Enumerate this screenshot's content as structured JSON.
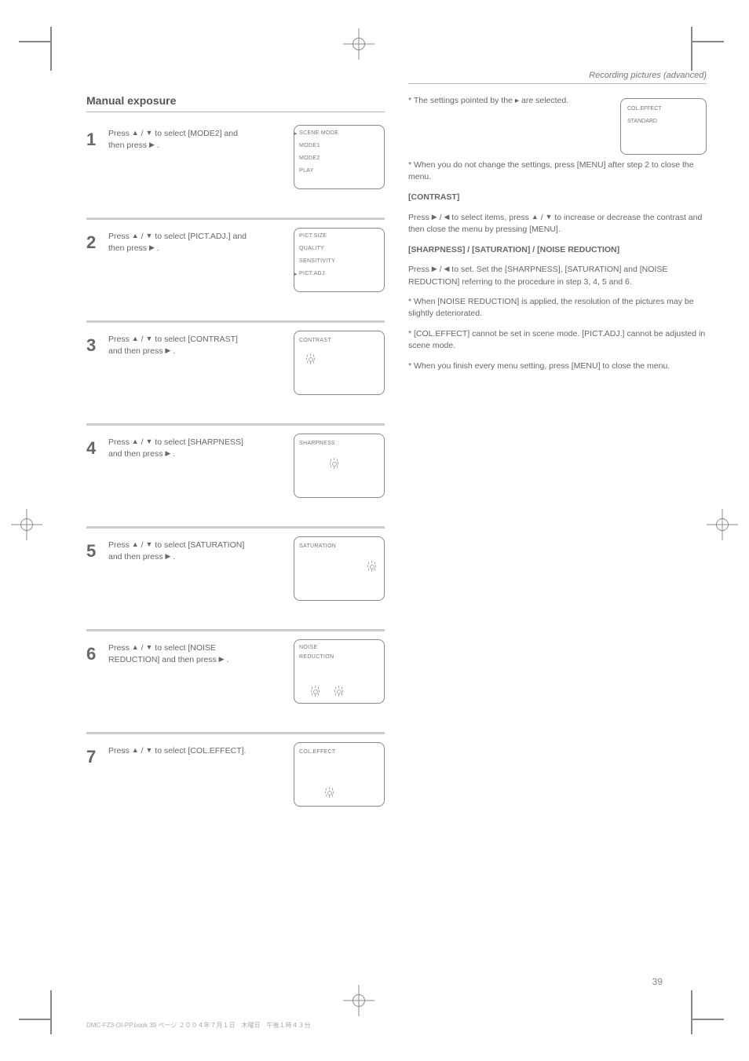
{
  "page_number": "39",
  "footer_line": "DMC-FZ3-OI-PP.book  39 ページ  ２００４年７月１日　木曜日　午後１時４３分",
  "left": {
    "title": "Manual exposure",
    "steps": [
      {
        "num": "1",
        "text_a": "Press ",
        "b1": "▲",
        "mid": "/",
        "b2": "▼",
        "text_b": " to select [MODE2] and then press ",
        "b3": "▶",
        "text_c": ".",
        "lcd": {
          "type": "menu",
          "rows": [
            "SCENE MODE",
            "MODE1",
            "MODE2",
            "PLAY"
          ],
          "sel": 1
        }
      },
      {
        "num": "2",
        "text_a": "Press ",
        "b1": "▲",
        "mid": "/",
        "b2": "▼",
        "text_b": " to select [PICT.ADJ.] and then press ",
        "b3": "▶",
        "text_c": ".",
        "lcd": {
          "type": "menu",
          "rows": [
            "PICT.SIZE",
            "QUALITY",
            "SENSITIVITY",
            "PICT.ADJ."
          ],
          "sel": 3
        }
      },
      {
        "num": "3",
        "text_a": "Press ",
        "b1": "▲",
        "mid": "/",
        "b2": "▼",
        "text_b": " to select [CONTRAST] and then press ",
        "b3": "▶",
        "text_c": ".",
        "lcd": {
          "type": "adj",
          "label": "CONTRAST",
          "pos": "c"
        }
      },
      {
        "num": "4",
        "text_a": "Press ",
        "b1": "▲",
        "mid": "/",
        "b2": "▼",
        "text_b": " to select [SHARPNESS] and then press ",
        "b3": "▶",
        "text_c": ".",
        "lcd": {
          "type": "adj",
          "label": "SHARPNESS",
          "pos": "c"
        }
      },
      {
        "num": "5",
        "text_a": "Press ",
        "b1": "▲",
        "mid": "/",
        "b2": "▼",
        "text_b": " to select [SATURATION] and then press ",
        "b3": "▶",
        "text_c": ".",
        "lcd": {
          "type": "adj",
          "label": "SATURATION",
          "pos": "r"
        }
      },
      {
        "num": "6",
        "text_a": "Press ",
        "b1": "▲",
        "mid": "/",
        "b2": "▼",
        "text_b": " to select [NOISE REDUCTION] and then press ",
        "b3": "▶",
        "text_c": ".",
        "lcd": {
          "type": "adj2",
          "l1": "NOISE",
          "l2": "REDUCTION"
        }
      },
      {
        "num": "7",
        "text_a": "Press ",
        "b1": "▲",
        "mid": "/",
        "b2": "▼",
        "text_b": " to select [COL.EFFECT].",
        "b3": "",
        "text_c": "",
        "lcd": {
          "type": "adj",
          "label": "COL.EFFECT",
          "pos": "c"
        }
      }
    ]
  },
  "right": {
    "title": "Recording pictures (advanced)",
    "rbox": {
      "r1": "COL.EFFECT",
      "r2": "STANDARD"
    },
    "p1a": "* The settings pointed by the ",
    "p1_icon": "cursor",
    "p1b": " are selected.",
    "p2": "* When you do not change the settings, press [MENU] after step 2 to close the menu.",
    "p3": "[CONTRAST]",
    "p3_body_a": "Press ",
    "p3_r": "▶",
    "p3_mid": "/",
    "p3_l": "◀",
    "p3_body_b": " to select items, press ",
    "p3_u": "▲",
    "p3_body_c": " /",
    "p3_d": "▼",
    "p3_body_d": " to increase or decrease the contrast and then close the menu by pressing [MENU].",
    "p4": "[SHARPNESS] / [SATURATION] / [NOISE REDUCTION]",
    "p4_body_a": "Press ",
    "p4_r": "▶",
    "p4_mid": "/",
    "p4_l": "◀",
    "p4_body_b": " to set. Set the [SHARPNESS], [SATURATION] and [NOISE REDUCTION] referring to the procedure in step 3, 4, 5 and 6.",
    "p5": "* When [NOISE REDUCTION] is applied, the resolution of the pictures may be slightly deteriorated.",
    "p6": "* [COL.EFFECT] cannot be set in scene mode. [PICT.ADJ.] cannot be adjusted in scene mode.",
    "p7": "* When you finish every menu setting, press [MENU] to close the menu."
  }
}
